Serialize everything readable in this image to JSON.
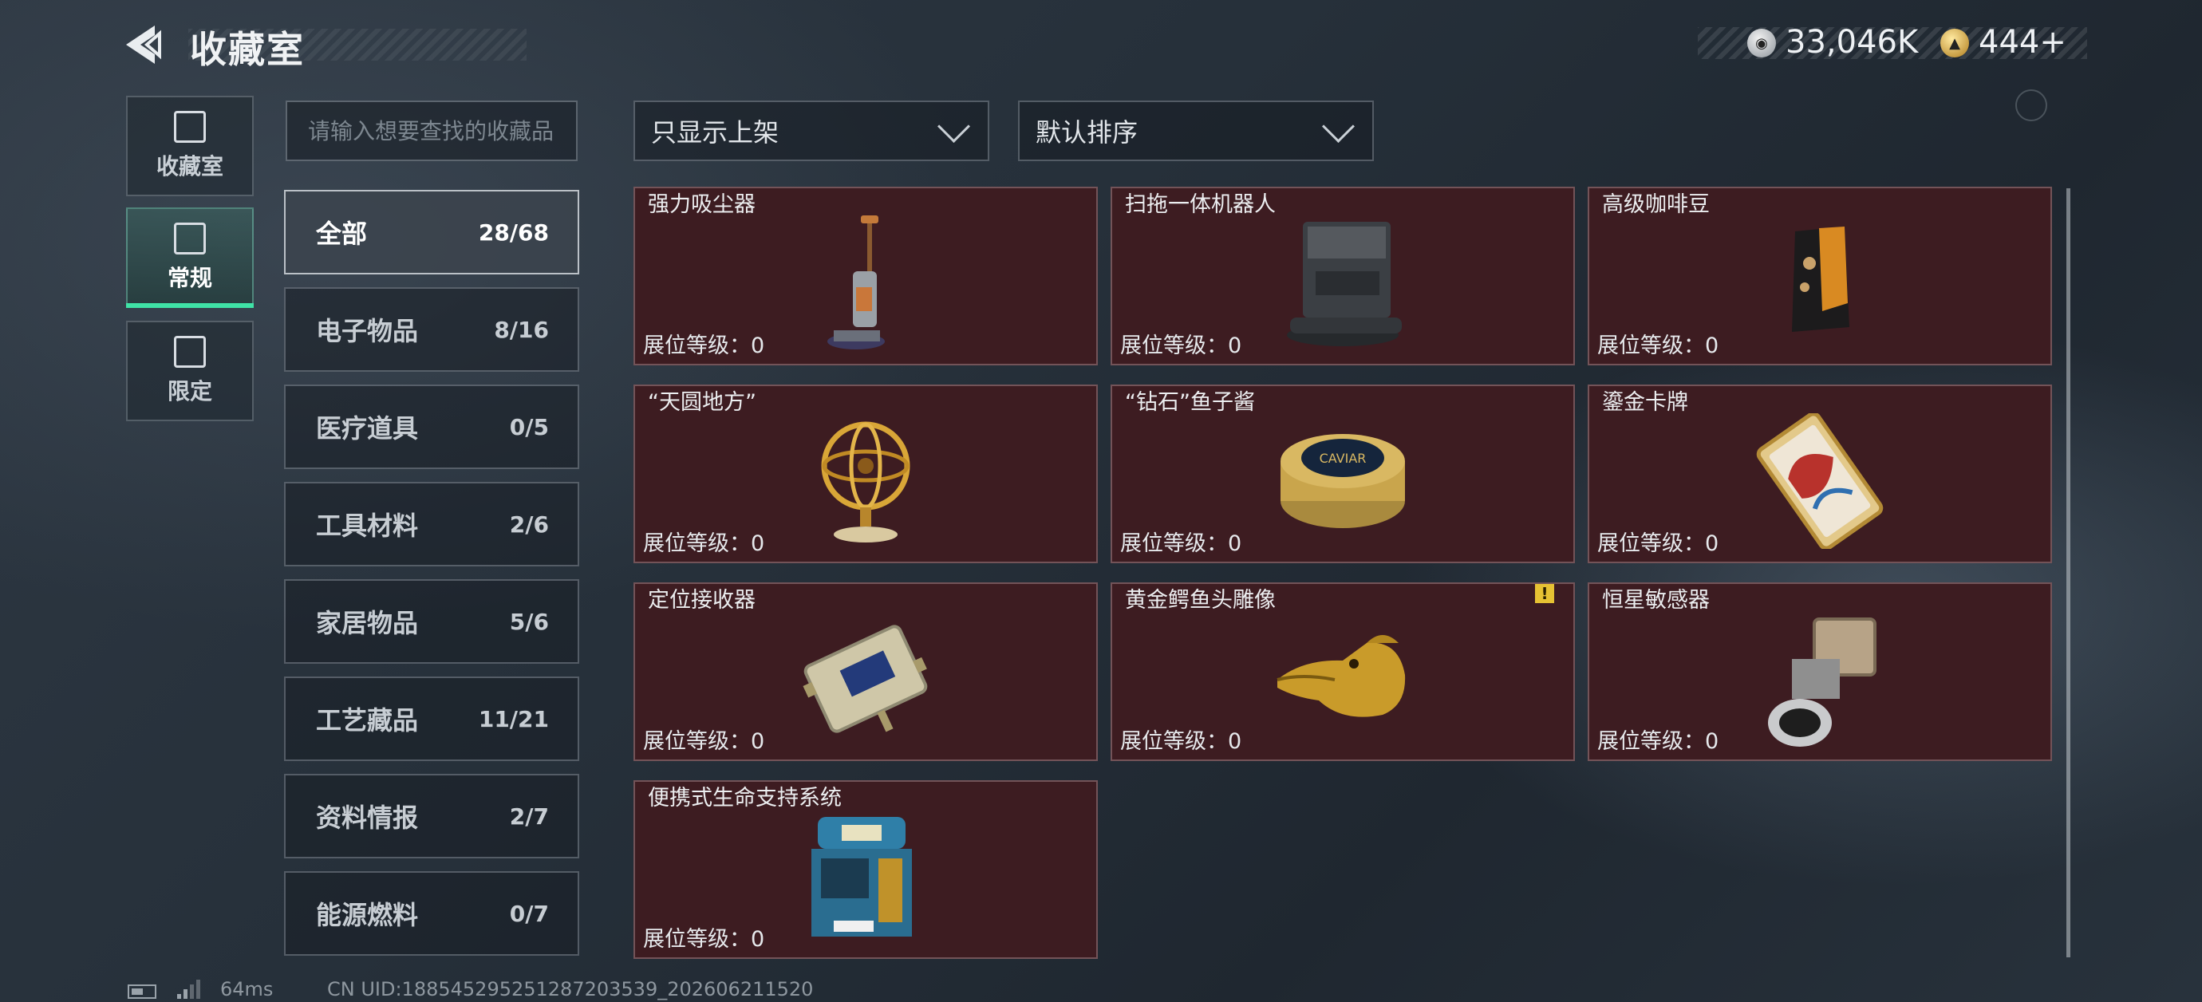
{
  "header": {
    "title": "收藏室",
    "currency": [
      {
        "icon": "silver-coin-icon",
        "value": "33,046K"
      },
      {
        "icon": "gold-coin-icon",
        "value": "444+"
      }
    ]
  },
  "side_tabs": [
    {
      "icon": "collection-room-icon",
      "label": "收藏室"
    },
    {
      "icon": "regular-icon",
      "label": "常规",
      "active": true
    },
    {
      "icon": "limited-icon",
      "label": "限定"
    }
  ],
  "search": {
    "placeholder": "请输入想要查找的收藏品",
    "value": ""
  },
  "filter_dropdown": {
    "selected": "只显示上架"
  },
  "sort_dropdown": {
    "selected": "默认排序"
  },
  "categories": [
    {
      "name": "全部",
      "count": "28/68",
      "active": true
    },
    {
      "name": "电子物品",
      "count": "8/16"
    },
    {
      "name": "医疗道具",
      "count": "0/5"
    },
    {
      "name": "工具材料",
      "count": "2/6"
    },
    {
      "name": "家居物品",
      "count": "5/6"
    },
    {
      "name": "工艺藏品",
      "count": "11/21"
    },
    {
      "name": "资料情报",
      "count": "2/7"
    },
    {
      "name": "能源燃料",
      "count": "0/7"
    }
  ],
  "items": [
    {
      "name": "强力吸尘器",
      "level": "展位等级：0",
      "icon": "vacuum-cleaner-icon"
    },
    {
      "name": "扫拖一体机器人",
      "level": "展位等级：0",
      "icon": "mop-robot-icon"
    },
    {
      "name": "高级咖啡豆",
      "level": "展位等级：0",
      "icon": "coffee-bag-icon"
    },
    {
      "name": "“天圆地方”",
      "level": "展位等级：0",
      "icon": "armillary-sphere-icon"
    },
    {
      "name": "“钻石”鱼子酱",
      "level": "展位等级：0",
      "icon": "caviar-tin-icon",
      "art_text": "CAVIAR"
    },
    {
      "name": "鎏金卡牌",
      "level": "展位等级：0",
      "icon": "gilded-card-icon"
    },
    {
      "name": "定位接收器",
      "level": "展位等级：0",
      "icon": "gps-receiver-icon"
    },
    {
      "name": "黄金鳄鱼头雕像",
      "level": "展位等级：0",
      "icon": "gold-crocodile-icon",
      "badge": "!"
    },
    {
      "name": "恒星敏感器",
      "level": "展位等级：0",
      "icon": "star-sensor-icon"
    },
    {
      "name": "便携式生命支持系统",
      "level": "展位等级：0",
      "icon": "life-support-icon"
    }
  ],
  "status_bar": {
    "ping": "64ms",
    "uid": "CN UID:18854529525128720353​9_202606211520"
  },
  "colors": {
    "card_bg": "#3d1c21",
    "active_tab_accent": "#3fe3a6",
    "warning": "#e6c233"
  }
}
